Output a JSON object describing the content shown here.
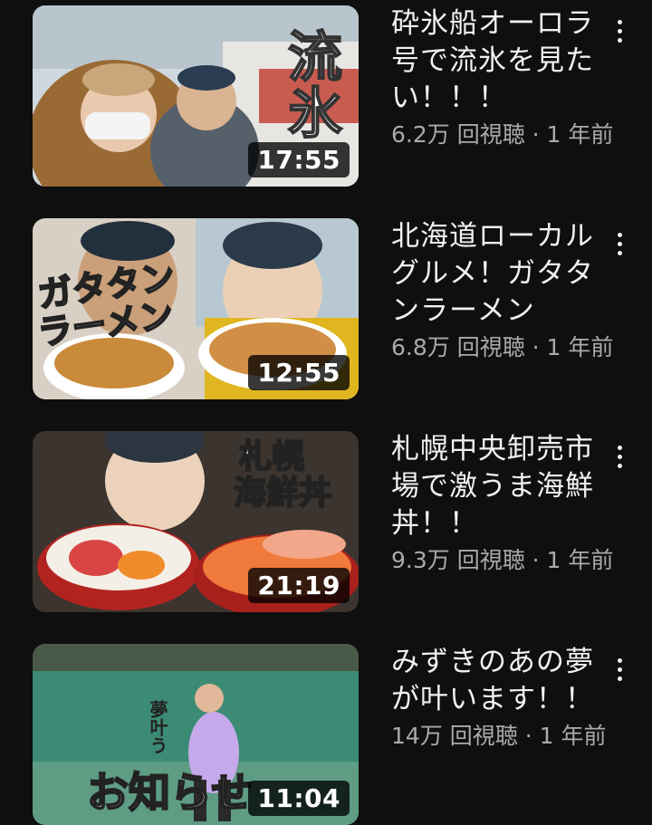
{
  "videos": [
    {
      "title": "砕氷船オーロラ号で流氷を見たい！！！",
      "meta": "6.2万 回視聴 · 1 年前",
      "duration": "17:55",
      "overlay_text": [
        "流",
        "氷"
      ],
      "palette": {
        "bg": "#c9d4dc",
        "accent": "#8a5a2a"
      }
    },
    {
      "title": "北海道ローカルグルメ！ガタタンラーメン",
      "meta": "6.8万 回視聴 · 1 年前",
      "duration": "12:55",
      "overlay_text": [
        "ガタタン",
        "ラーメン"
      ],
      "palette": {
        "bg": "#d9d2c4",
        "accent": "#e6b820"
      }
    },
    {
      "title": "札幌中央卸売市場で激うま海鮮丼！！",
      "meta": "9.3万 回視聴 · 1 年前",
      "duration": "21:19",
      "overlay_text": [
        "札幌",
        "海鮮丼"
      ],
      "palette": {
        "bg": "#3a3530",
        "accent": "#e8592a"
      }
    },
    {
      "title": "みずきのあの夢が叶います！！",
      "meta": "14万 回視聴 · 1 年前",
      "duration": "11:04",
      "overlay_text": [
        "夢叶う",
        "お知らせ"
      ],
      "palette": {
        "bg": "#3f8f78",
        "accent": "#b79be0"
      }
    }
  ],
  "icons": {
    "more": "more-vert-icon"
  }
}
